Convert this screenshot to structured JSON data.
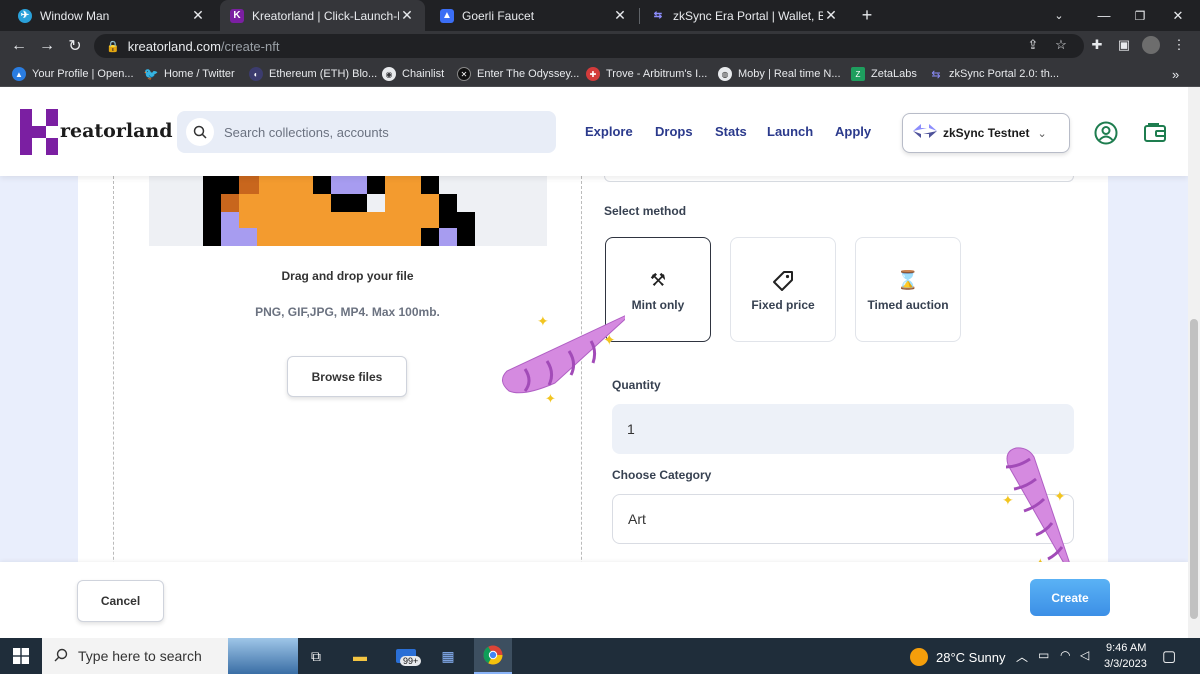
{
  "browser": {
    "tabs": [
      {
        "title": "Window Man",
        "favicon_color": "#2aa1da",
        "favicon_glyph": "✈",
        "active": false
      },
      {
        "title": "Kreatorland | Click-Launch-Mint",
        "favicon_color": "#7b1fa2",
        "favicon_glyph": "K",
        "active": true
      },
      {
        "title": "Goerli Faucet",
        "favicon_color": "#3b6ef5",
        "favicon_glyph": "▲",
        "active": false
      },
      {
        "title": "zkSync Era Portal | Wallet, Bridge",
        "favicon_color": "#4e529a",
        "favicon_glyph": "⇆",
        "active": false
      }
    ],
    "url_host": "kreatorland.com",
    "url_path": "/create-nft",
    "bookmarks": [
      {
        "label": "Your Profile | Open...",
        "color": "#2a7de1"
      },
      {
        "label": "Home / Twitter",
        "color": "#1da1f2"
      },
      {
        "label": "Ethereum (ETH) Blo...",
        "color": "#3c3c6e"
      },
      {
        "label": "Chainlist",
        "color": "#555555"
      },
      {
        "label": "Enter The Odyssey...",
        "color": "#222222"
      },
      {
        "label": "Trove - Arbitrum's I...",
        "color": "#d33b3b"
      },
      {
        "label": "Moby | Real time N...",
        "color": "#444444"
      },
      {
        "label": "ZetaLabs",
        "color": "#1e9e5e"
      },
      {
        "label": "zkSync Portal 2.0: th...",
        "color": "#4e529a"
      }
    ]
  },
  "header": {
    "logo_text": "reatorland",
    "search_placeholder": "Search collections, accounts",
    "nav": [
      "Explore",
      "Drops",
      "Stats",
      "Launch",
      "Apply"
    ],
    "network_label": "zkSync Testnet"
  },
  "upload": {
    "drag_text": "Drag and drop your file",
    "formats_text": "PNG, GIF,JPG, MP4. Max 100mb.",
    "browse_label": "Browse files"
  },
  "form": {
    "select_method_label": "Select method",
    "methods": [
      {
        "label": "Mint only",
        "icon": "hammer-pick-icon",
        "selected": true
      },
      {
        "label": "Fixed price",
        "icon": "price-tag-icon",
        "selected": false
      },
      {
        "label": "Timed auction",
        "icon": "hourglass-icon",
        "selected": false
      }
    ],
    "quantity_label": "Quantity",
    "quantity_value": "1",
    "category_label": "Choose Category",
    "category_value": "Art"
  },
  "footer": {
    "cancel_label": "Cancel",
    "create_label": "Create"
  },
  "taskbar": {
    "search_placeholder": "Type here to search",
    "mail_badge": "99+",
    "weather": "28°C  Sunny",
    "time": "9:46 AM",
    "date": "3/3/2023"
  },
  "colors": {
    "brand_purple": "#7b1fa2",
    "nav_blue": "#2b3a8c",
    "create_blue": "#3c8fe6",
    "page_bg": "#e9eefc",
    "icon_green": "#1e7d4f"
  }
}
